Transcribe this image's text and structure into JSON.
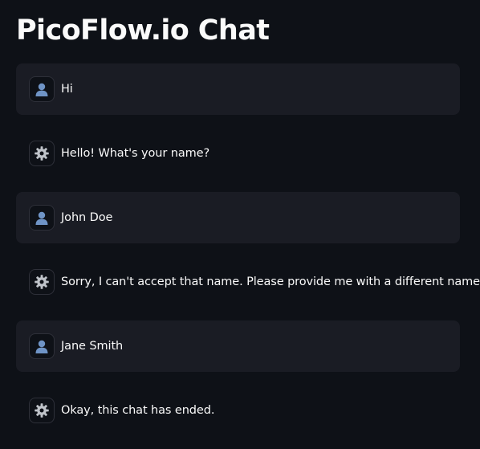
{
  "header": {
    "title": "PicoFlow.io Chat"
  },
  "colors": {
    "background": "#0e1117",
    "user_bubble": "#1a1c24",
    "text": "#fafafa"
  },
  "messages": [
    {
      "role": "user",
      "avatar_icon": "user-avatar-icon",
      "text": "Hi"
    },
    {
      "role": "assistant",
      "avatar_icon": "gear-icon",
      "text": "Hello! What's your name?"
    },
    {
      "role": "user",
      "avatar_icon": "user-avatar-icon",
      "text": "John Doe"
    },
    {
      "role": "assistant",
      "avatar_icon": "gear-icon",
      "text": "Sorry, I can't accept that name. Please provide me with a different name."
    },
    {
      "role": "user",
      "avatar_icon": "user-avatar-icon",
      "text": "Jane Smith"
    },
    {
      "role": "assistant",
      "avatar_icon": "gear-icon",
      "text": "Okay, this chat has ended."
    }
  ]
}
